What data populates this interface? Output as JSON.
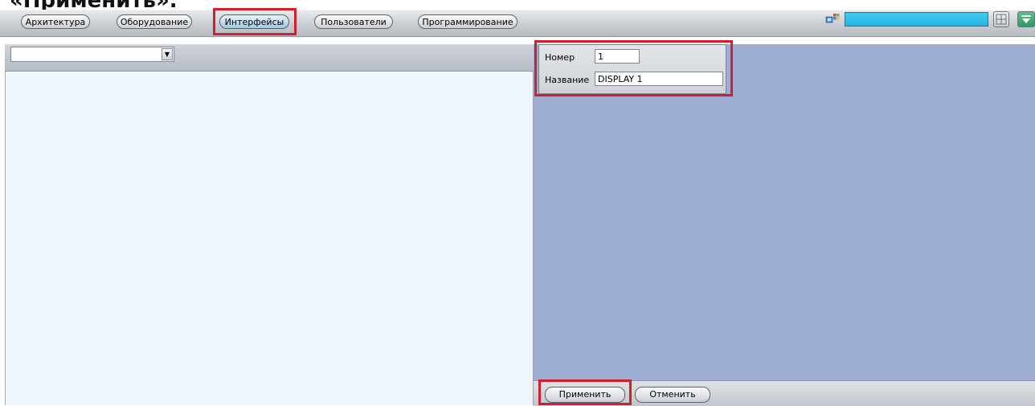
{
  "heading_fragment": "«Применить».",
  "tabs": [
    {
      "label": "Архитектура"
    },
    {
      "label": "Оборудование"
    },
    {
      "label": "Интерфейсы",
      "active": true
    },
    {
      "label": "Пользователи"
    },
    {
      "label": "Программирование"
    }
  ],
  "toolbar": {
    "search_value": "",
    "icons": [
      "windows-logo-icon",
      "layout-grid-icon",
      "dropdown-arrow-icon"
    ]
  },
  "left_panel": {
    "combo_value": ""
  },
  "properties": {
    "number_label": "Номер",
    "number_value": "1",
    "name_label": "Название",
    "name_value": "DISPLAY 1"
  },
  "actions": {
    "apply_label": "Применить",
    "cancel_label": "Отменить"
  },
  "colors": {
    "highlight": "#d21f2c",
    "right_pane": "#9eaed2",
    "left_pane": "#eff7fc",
    "search_field": "#26b5e2"
  }
}
